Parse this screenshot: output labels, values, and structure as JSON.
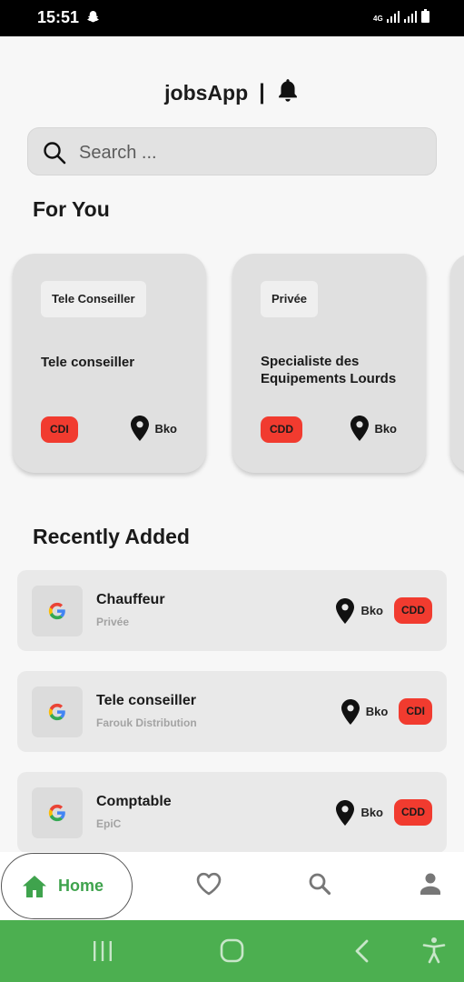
{
  "status_bar": {
    "time": "15:51",
    "network": "4G"
  },
  "app": {
    "title": "jobsApp",
    "separator": "|"
  },
  "search": {
    "placeholder": "Search ..."
  },
  "for_you": {
    "title": "For You",
    "cards": [
      {
        "category": "Tele Conseiller",
        "job_title": "Tele conseiller",
        "contract": "CDI",
        "location": "Bko"
      },
      {
        "category": "Privée",
        "job_title": "Specialiste des Equipements Lourds",
        "contract": "CDD",
        "location": "Bko"
      }
    ]
  },
  "recently_added": {
    "title": "Recently Added",
    "items": [
      {
        "job_title": "Chauffeur",
        "company": "Privée",
        "location": "Bko",
        "contract": "CDD"
      },
      {
        "job_title": "Tele conseiller",
        "company": "Farouk Distribution",
        "location": "Bko",
        "contract": "CDI"
      },
      {
        "job_title": "Comptable",
        "company": "EpiC",
        "location": "Bko",
        "contract": "CDD"
      }
    ]
  },
  "bottom_nav": {
    "items": [
      {
        "label": "Home",
        "icon": "home-icon",
        "active": true
      },
      {
        "label": "",
        "icon": "heart-icon",
        "active": false
      },
      {
        "label": "",
        "icon": "search-icon",
        "active": false
      },
      {
        "label": "",
        "icon": "person-icon",
        "active": false
      }
    ]
  },
  "colors": {
    "accent_green": "#3fa34d",
    "system_nav_green": "#4caf50",
    "contract_badge_red": "#f13b2f",
    "card_background": "#e0e0e0"
  }
}
